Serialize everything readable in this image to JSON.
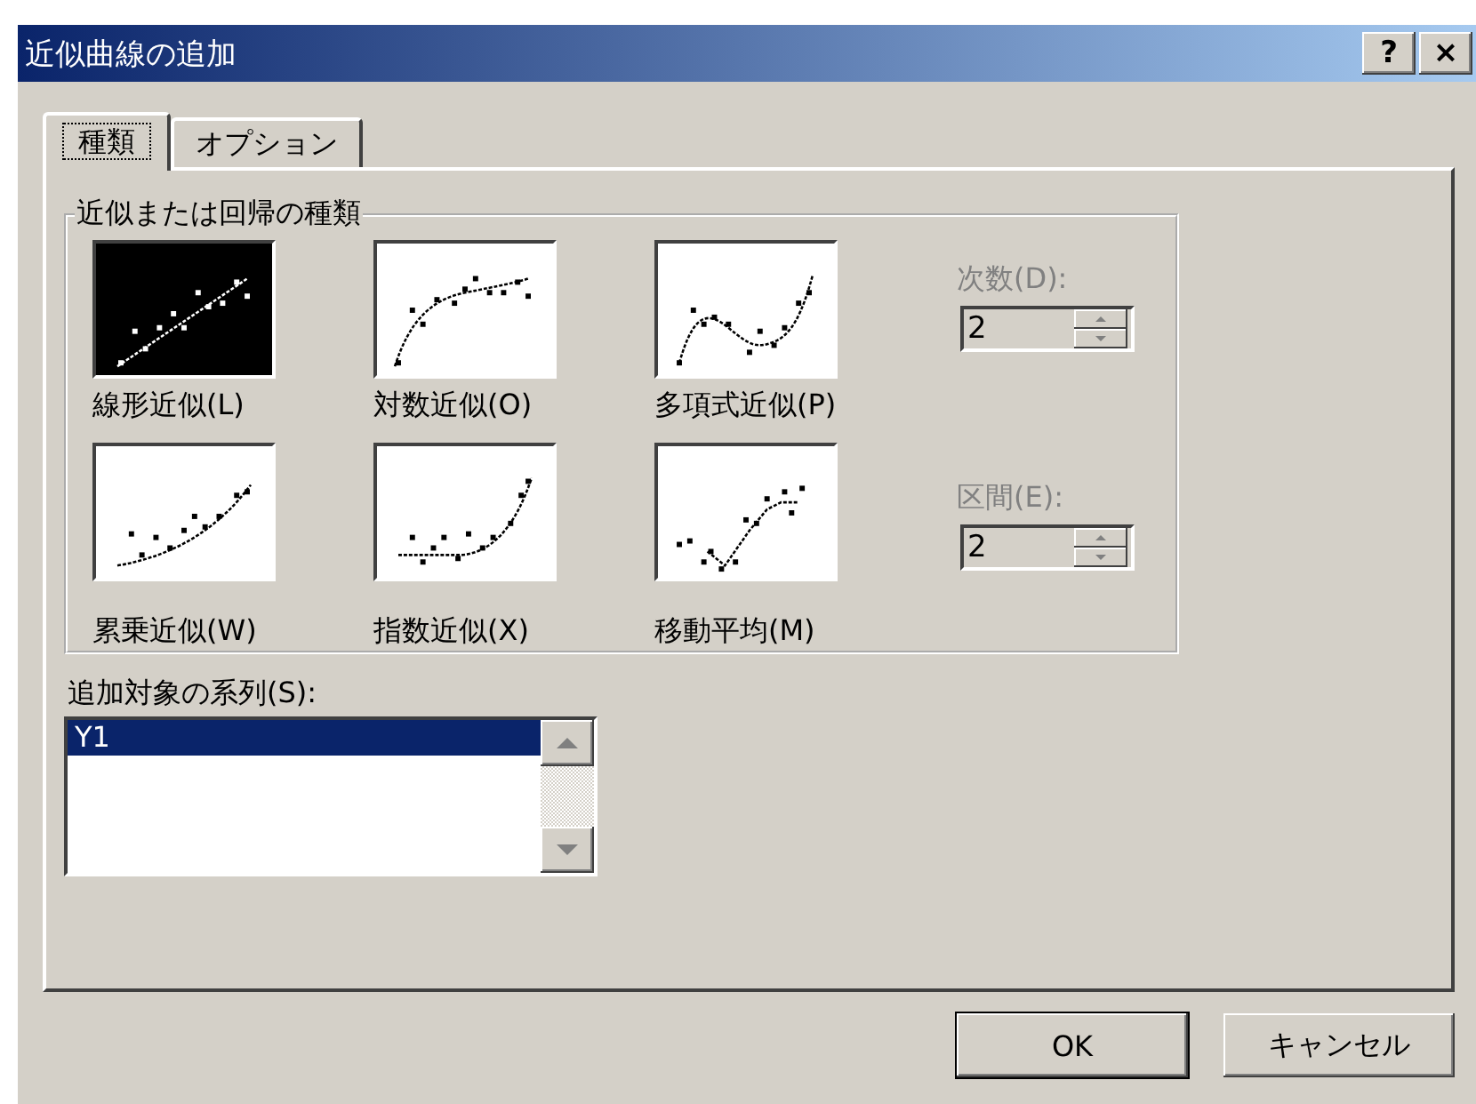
{
  "window": {
    "title": "近似曲線の追加",
    "help_button": "?",
    "close_button": "×"
  },
  "tabs": [
    {
      "label": "種類",
      "selected": true
    },
    {
      "label": "オプション",
      "selected": false
    }
  ],
  "trend_group": {
    "title": "近似または回帰の種類",
    "types": [
      {
        "kind": "linear",
        "label": "線形近似(L)",
        "selected": true
      },
      {
        "kind": "logarithmic",
        "label": "対数近似(O)",
        "selected": false
      },
      {
        "kind": "polynomial",
        "label": "多項式近似(P)",
        "selected": false
      },
      {
        "kind": "power",
        "label": "累乗近似(W)",
        "selected": false
      },
      {
        "kind": "exponential",
        "label": "指数近似(X)",
        "selected": false
      },
      {
        "kind": "moving_average",
        "label": "移動平均(M)",
        "selected": false
      }
    ]
  },
  "spinners": [
    {
      "label": "次数(D):",
      "value": "2",
      "disabled": true
    },
    {
      "label": "区間(E):",
      "value": "2",
      "disabled": true
    }
  ],
  "series_list": {
    "label": "追加対象の系列(S):",
    "items": [
      {
        "label": "Y1",
        "selected": true
      }
    ]
  },
  "buttons": [
    {
      "label": "OK",
      "default": true
    },
    {
      "label": "キャンセル",
      "default": false
    }
  ]
}
